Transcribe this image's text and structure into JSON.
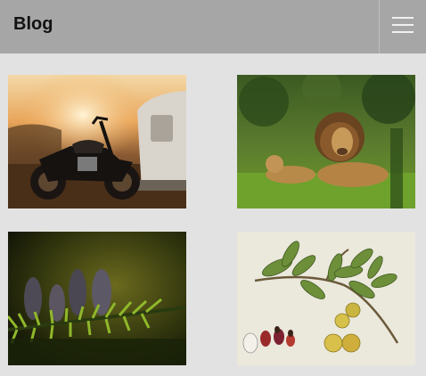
{
  "header": {
    "title": "Blog",
    "menu_icon": "hamburger-menu-icon"
  },
  "gallery": {
    "items": [
      {
        "image": "motorcycle-camper-sunset-photo"
      },
      {
        "image": "lions-in-grass-photo"
      },
      {
        "image": "pine-cones-on-branch-photo"
      },
      {
        "image": "botanical-nutmeg-illustration"
      }
    ]
  },
  "colors": {
    "page_background": "#e2e2e2",
    "header_background": "#a6a6a6"
  }
}
